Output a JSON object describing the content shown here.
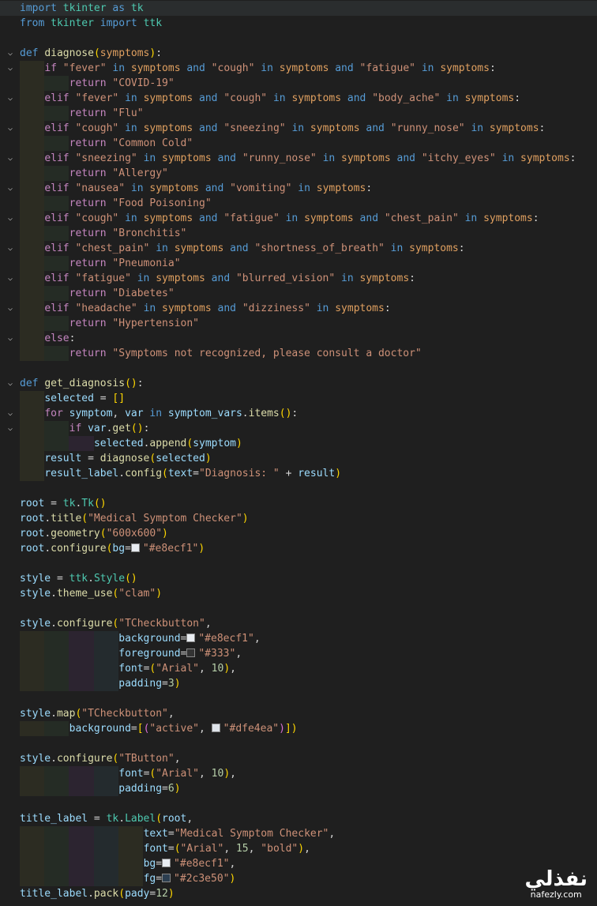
{
  "editor": {
    "language": "python",
    "lines": [
      "import tkinter as tk",
      "from tkinter import ttk",
      "",
      "def diagnose(symptoms):",
      "    if \"fever\" in symptoms and \"cough\" in symptoms and \"fatigue\" in symptoms:",
      "        return \"COVID-19\"",
      "    elif \"fever\" in symptoms and \"cough\" in symptoms and \"body_ache\" in symptoms:",
      "        return \"Flu\"",
      "    elif \"cough\" in symptoms and \"sneezing\" in symptoms and \"runny_nose\" in symptoms:",
      "        return \"Common Cold\"",
      "    elif \"sneezing\" in symptoms and \"runny_nose\" in symptoms and \"itchy_eyes\" in symptoms:",
      "        return \"Allergy\"",
      "    elif \"nausea\" in symptoms and \"vomiting\" in symptoms:",
      "        return \"Food Poisoning\"",
      "    elif \"cough\" in symptoms and \"fatigue\" in symptoms and \"chest_pain\" in symptoms:",
      "        return \"Bronchitis\"",
      "    elif \"chest_pain\" in symptoms and \"shortness_of_breath\" in symptoms:",
      "        return \"Pneumonia\"",
      "    elif \"fatigue\" in symptoms and \"blurred_vision\" in symptoms:",
      "        return \"Diabetes\"",
      "    elif \"headache\" in symptoms and \"dizziness\" in symptoms:",
      "        return \"Hypertension\"",
      "    else:",
      "        return \"Symptoms not recognized, please consult a doctor\"",
      "",
      "def get_diagnosis():",
      "    selected = []",
      "    for symptom, var in symptom_vars.items():",
      "        if var.get():",
      "            selected.append(symptom)",
      "    result = diagnose(selected)",
      "    result_label.config(text=\"Diagnosis: \" + result)",
      "",
      "root = tk.Tk()",
      "root.title(\"Medical Symptom Checker\")",
      "root.geometry(\"600x600\")",
      "root.configure(bg=\"#e8ecf1\")",
      "",
      "style = ttk.Style()",
      "style.theme_use(\"clam\")",
      "",
      "style.configure(\"TCheckbutton\",",
      "                background=\"#e8ecf1\",",
      "                foreground=\"#333\",",
      "                font=(\"Arial\", 10),",
      "                padding=3)",
      "",
      "style.map(\"TCheckbutton\",",
      "        background=[(\"active\", \"#dfe4ea\")])",
      "",
      "style.configure(\"TButton\",",
      "                font=(\"Arial\", 10),",
      "                padding=6)",
      "",
      "title_label = tk.Label(root,",
      "                    text=\"Medical Symptom Checker\",",
      "                    font=(\"Arial\", 15, \"bold\"),",
      "                    bg=\"#e8ecf1\",",
      "                    fg=\"#2c3e50\")",
      "title_label.pack(pady=12)"
    ],
    "color_swatches": {
      "e8ecf1": "#e8ecf1",
      "dfe4ea": "#dfe4ea",
      "2c3e50": "#2c3e50"
    }
  },
  "watermark": {
    "arabic": "نفذلي",
    "latin": "nafezly.com"
  }
}
